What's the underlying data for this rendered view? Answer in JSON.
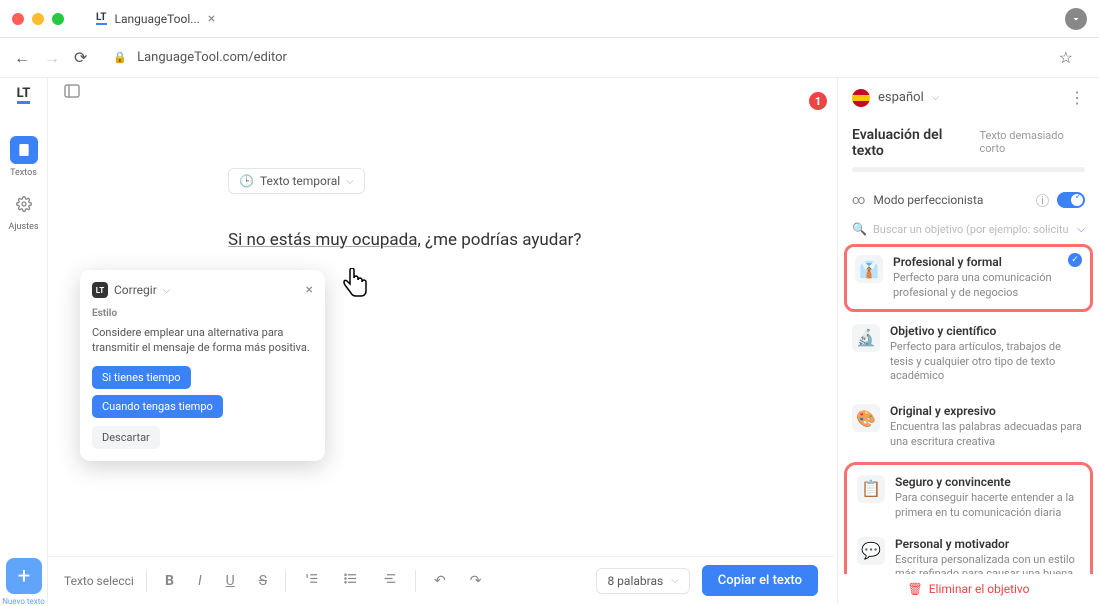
{
  "browser": {
    "tab_title": "LanguageTool...",
    "url": "LanguageTool.com/editor"
  },
  "sidebar": {
    "items": [
      {
        "label": "Textos"
      },
      {
        "label": "Ajustes"
      }
    ],
    "new_text_label": "Nuevo texto"
  },
  "editor": {
    "doc_title": "Texto temporal",
    "text_before": "Si no estás muy ocupada,",
    "text_after": " ¿me podrías ayudar?",
    "error_count": "1"
  },
  "correction": {
    "header": "Corregir",
    "category": "Estilo",
    "message": "Considere emplear una alternativa para transmitir el mensaje de forma más positiva.",
    "suggestions": [
      "Si tienes tiempo",
      "Cuando tengas tiempo"
    ],
    "discard": "Descartar"
  },
  "toolbar": {
    "text_select_placeholder": "Texto seleccio",
    "word_count": "8 palabras",
    "copy_label": "Copiar el texto"
  },
  "right_panel": {
    "language": "español",
    "eval_title": "Evaluación del texto",
    "eval_status": "Texto demasiado corto",
    "mode_label": "Modo perfeccionista",
    "search_placeholder": "Buscar un objetivo (por ejemplo: solicitu",
    "objectives": [
      {
        "title": "Profesional y formal",
        "desc": "Perfecto para una comunicación profesional y de negocios",
        "icon": "👔",
        "selected": true
      },
      {
        "title": "Objetivo y científico",
        "desc": "Perfecto para artículos, trabajos de tesis y cualquier otro tipo de texto académico",
        "icon": "🔬",
        "selected": false
      },
      {
        "title": "Original y expresivo",
        "desc": "Encuentra las palabras adecuadas para una escritura creativa",
        "icon": "🎨",
        "selected": false
      },
      {
        "title": "Seguro y convincente",
        "desc": "Para conseguir hacerte entender a la primera en tu comunicación diaria",
        "icon": "📋",
        "selected": false
      },
      {
        "title": "Personal y motivador",
        "desc": "Escritura personalizada con un estilo más refinado para causar una buena impresión a tus compañeros",
        "icon": "💬",
        "selected": false
      }
    ],
    "delete_label": "Eliminar el objetivo"
  }
}
